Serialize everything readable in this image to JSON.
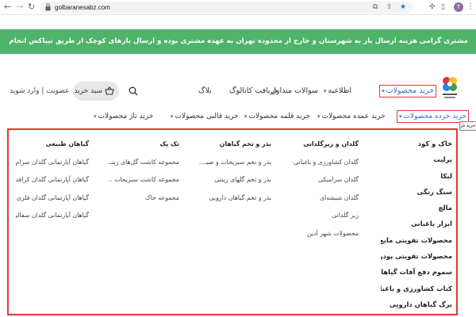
{
  "browser": {
    "url": "golbaranesabz.com",
    "avatar_letter": "T",
    "more_icon": "kebab-menu-icon"
  },
  "banner": {
    "text": "مشتری گرامی هزینه ارسال بار به شهرستان و خارج از محدوده تهران به عهده مشتری بوده و ارسال بارهای کوچک از طریق تیپاکس انجام می شود."
  },
  "header": {
    "nav": {
      "products": "خرید محصولات",
      "news": "اطلاعیه",
      "faq": "سوالات متداول",
      "catalog": "دریافت کاتالوگ",
      "blog": "بلاگ"
    },
    "cart_label": "سبد خرید",
    "auth": "عضویت | وارد شوید"
  },
  "subnav": {
    "retail": "خرید خرده محصولات",
    "wholesale": "خرید عمده محصولات",
    "pots": "خرید قلمه محصولات",
    "molds": "خرید قالبی محصولات",
    "new": "خرید تاژ محصولات",
    "tooltip": "خرید خرده محصولات"
  },
  "mega_menu": {
    "col1": [
      "خاک و کود",
      "پرلیت",
      "لیکا",
      "سنگ رنگی",
      "مالچ",
      "ابزار باغبانی",
      "محصولات تقویتی مایع",
      "محصولات تقویتی پودری",
      "سموم دفع آفات گیاهان",
      "کتاب کشاورزی و باغبانی",
      "برگ گیاهان دارویی"
    ],
    "col2": {
      "head": "گلدان و زیرگلدانی",
      "items": [
        "گلدان کشاورزی و باغبانی",
        "گلدان سرامیکی",
        "گلدان شیشه‌ای",
        "زیر گلدانی",
        "محصولات شهر آذین"
      ]
    },
    "col3": {
      "head": "بذر و تخم گیاهان",
      "items": [
        "بذر و تخم سبزیجات و صیـ...",
        "بذر و تخم گلهای زینتی",
        "بذر و تخم گیاهان دارویی"
      ]
    },
    "col4": {
      "head": "تک پک",
      "items": [
        "مجموعه کاشت گل‌های زینـ...",
        "مجموعه کاشت سبزیجات ...",
        "مجموعه خاک"
      ]
    },
    "col5": {
      "head": "گیاهان طبیعی",
      "items": [
        "گیاهان آپارتمانی گلدان سرام...",
        "گیاهان آپارتمانی گلدان کرافتی",
        "گیاهان آپارتمانی گلدان فلزی",
        "گیاهان آپارتمانی گلدان سفالی"
      ]
    }
  },
  "colors": {
    "banner": "#4fb46a",
    "highlight": "#e53935",
    "link": "#2f6fbf"
  }
}
